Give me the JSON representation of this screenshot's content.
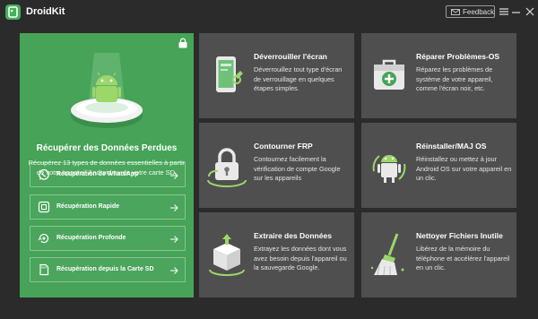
{
  "app": {
    "title": "DroidKit"
  },
  "titlebar": {
    "feedback_label": "Feedback",
    "icons": [
      "mail-icon",
      "menu-icon",
      "minimize-icon",
      "close-icon"
    ]
  },
  "colors": {
    "accent": "#46a357",
    "card": "#4f4f4f",
    "background": "#2b2b2b"
  },
  "hero": {
    "title": "Récupérer des Données Perdues",
    "description": "Récupérez 13 types de données essentielles à partir de votre appareil Android ou de votre carte SD.",
    "items": [
      {
        "label": "Récupération de WhatsApp",
        "icon": "whatsapp-icon"
      },
      {
        "label": "Récupération Rapide",
        "icon": "quick-scan-icon"
      },
      {
        "label": "Récupération Profonde",
        "icon": "deep-scan-icon"
      },
      {
        "label": "Récupération depuis la Carte SD",
        "icon": "sd-card-icon"
      }
    ]
  },
  "cards": [
    {
      "title": "Déverrouiller l'écran",
      "description": "Déverrouillez tout type d'écran de verrouillage en quelques étapes simples.",
      "icon": "phone-unlock-icon"
    },
    {
      "title": "Réparer Problèmes-OS",
      "description": "Réparez les problèmes de système de votre appareil, comme l'écran noir, etc.",
      "icon": "first-aid-kit-icon"
    },
    {
      "title": "Contourner FRP",
      "description": "Contournez facilement la vérification de compte Google sur les appareils",
      "icon": "padlock-icon"
    },
    {
      "title": "Réinstaller/MAJ OS",
      "description": "Réinstallez ou mettez à jour Android OS sur votre appareil en un clic.",
      "icon": "android-robot-icon"
    },
    {
      "title": "Extraire des Données",
      "description": "Extrayez les données dont vous avez besoin depuis l'appareil ou la sauvegarde Google.",
      "icon": "extract-box-icon"
    },
    {
      "title": "Nettoyer Fichiers Inutile",
      "description": "Libérez de la mémoire du téléphone et accélérez l'appareil en un clic.",
      "icon": "broom-icon"
    }
  ]
}
